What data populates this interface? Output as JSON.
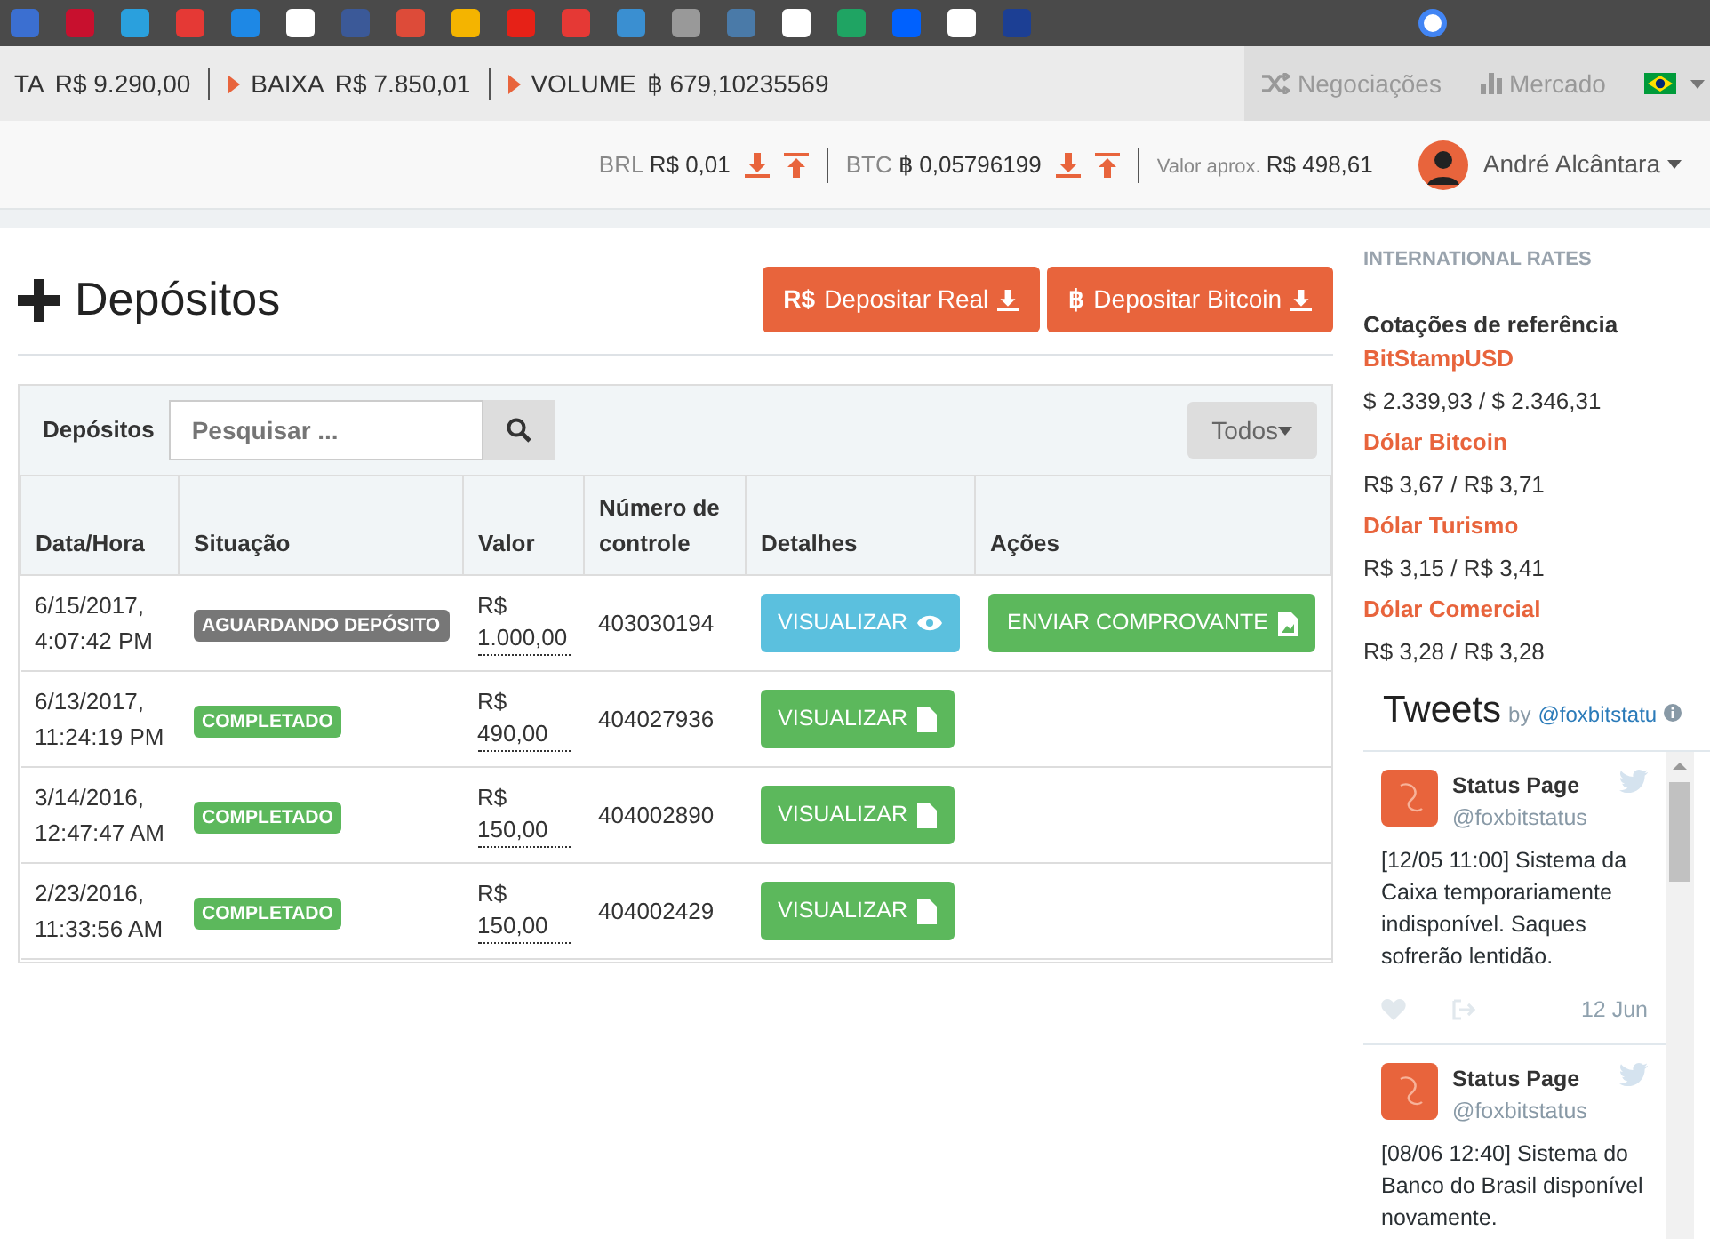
{
  "ticker": [
    {
      "label": "TA",
      "value": "R$ 9.290,00",
      "arrow": false
    },
    {
      "label": "BAIXA",
      "value": "R$ 7.850,01",
      "arrow": true
    },
    {
      "label": "VOLUME",
      "value": "฿ 679,10235569",
      "arrow": true
    }
  ],
  "nav": [
    {
      "label": "Negociações",
      "kind": "trades"
    },
    {
      "label": "Mercado",
      "kind": "market"
    }
  ],
  "balances": [
    {
      "currency": "BRL",
      "amount": "R$ 0,01"
    },
    {
      "currency": "BTC",
      "amount": "฿ 0,05796199"
    }
  ],
  "approx": {
    "label": "Valor aprox.",
    "amount": "R$ 498,61"
  },
  "user": {
    "name": "André Alcântara"
  },
  "page_title": "Depósitos",
  "deposit_buttons": [
    {
      "prefix": "R$",
      "label": "Depositar Real"
    },
    {
      "prefix": "฿",
      "label": "Depositar Bitcoin"
    }
  ],
  "panel": {
    "label": "Depósitos",
    "search": {
      "placeholder": "Pesquisar ..."
    },
    "filter": "Todos"
  },
  "table": {
    "columns": [
      "Data/Hora",
      "Situação",
      "Valor",
      "Número de controle",
      "Detalhes",
      "Ações"
    ],
    "rows": [
      {
        "date": "6/15/2017, 4:07:42 PM",
        "status": {
          "text": "AGUARDANDO DEPÓSITO",
          "kind": "pending"
        },
        "value": "R$ 1.000,00",
        "control": "403030194",
        "details": {
          "label": "VISUALIZAR",
          "kind": "info"
        },
        "action": "ENVIAR COMPROVANTE"
      },
      {
        "date": "6/13/2017, 11:24:19 PM",
        "status": {
          "text": "COMPLETADO",
          "kind": "done"
        },
        "value": "R$ 490,00",
        "control": "404027936",
        "details": {
          "label": "VISUALIZAR",
          "kind": "success"
        }
      },
      {
        "date": "3/14/2016, 12:47:47 AM",
        "status": {
          "text": "COMPLETADO",
          "kind": "done"
        },
        "value": "R$ 150,00",
        "control": "404002890",
        "details": {
          "label": "VISUALIZAR",
          "kind": "success"
        }
      },
      {
        "date": "2/23/2016, 11:33:56 AM",
        "status": {
          "text": "COMPLETADO",
          "kind": "done"
        },
        "value": "R$ 150,00",
        "control": "404002429",
        "details": {
          "label": "VISUALIZAR",
          "kind": "success"
        }
      }
    ]
  },
  "sidebar": {
    "heading": "INTERNATIONAL RATES",
    "subheading": "Cotações de referência",
    "rates": [
      {
        "name": "BitStampUSD",
        "value": "$ 2.339,93 / $ 2.346,31"
      },
      {
        "name": "Dólar Bitcoin",
        "value": "R$ 3,67 / R$ 3,71"
      },
      {
        "name": "Dólar Turismo",
        "value": "R$ 3,15 / R$ 3,41"
      },
      {
        "name": "Dólar Comercial",
        "value": "R$ 3,28 / R$ 3,28"
      }
    ],
    "tweets": {
      "title": "Tweets",
      "by": "by",
      "handle": "@foxbitstatu",
      "items": [
        {
          "name": "Status Page",
          "handle": "@foxbitstatus",
          "text": "[12/05 11:00] Sistema da Caixa temporariamente indisponível. Saques sofrerão lentidão.",
          "date": "12 Jun"
        },
        {
          "name": "Status Page",
          "handle": "@foxbitstatus",
          "text": "[08/06 12:40] Sistema do Banco do Brasil disponível novamente."
        }
      ]
    }
  }
}
